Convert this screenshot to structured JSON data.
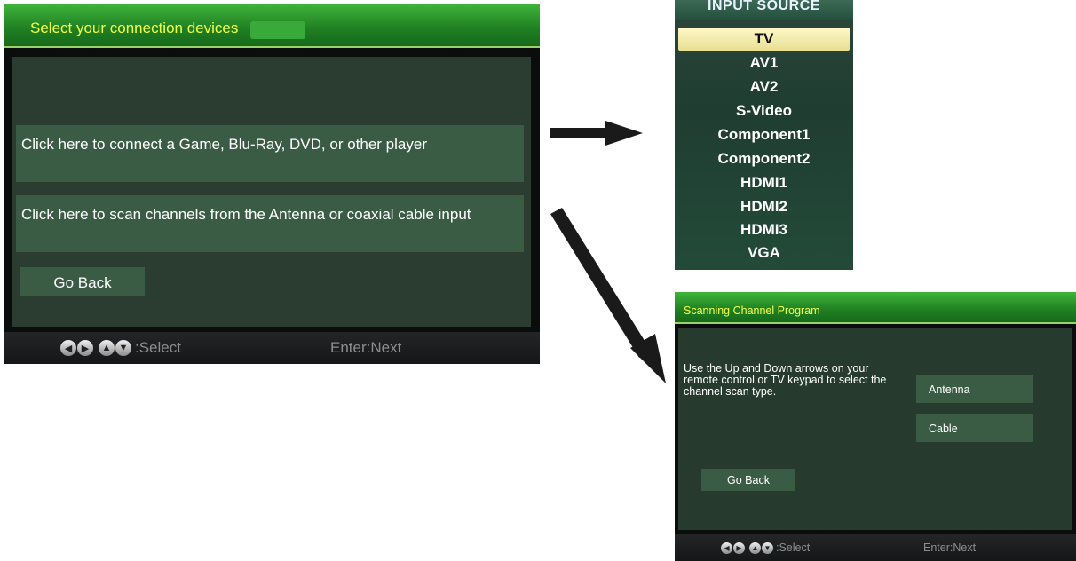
{
  "connection_screen": {
    "title": "Select your connection devices",
    "options": [
      {
        "label": "Click here to connect a Game, Blu-Ray, DVD, or other player"
      },
      {
        "label": "Click here to scan channels from the Antenna or coaxial cable input"
      }
    ],
    "go_back_label": "Go Back",
    "footer": {
      "select_label": ":Select",
      "next_label": "Enter:Next",
      "icons": [
        "left-arrow-icon",
        "right-arrow-icon",
        "up-arrow-icon",
        "down-arrow-icon"
      ]
    }
  },
  "input_source_menu": {
    "header": "INPUT SOURCE",
    "selected": "TV",
    "items": [
      "TV",
      "AV1",
      "AV2",
      "S-Video",
      "Component1",
      "Component2",
      "HDMI1",
      "HDMI2",
      "HDMI3",
      "VGA"
    ]
  },
  "scan_screen": {
    "title": "Scanning Channel Program",
    "description": "Use the Up and Down arrows on your remote control or TV keypad to select the channel scan type.",
    "options": [
      {
        "label": "Antenna"
      },
      {
        "label": "Cable"
      }
    ],
    "go_back_label": "Go Back",
    "footer": {
      "select_label": ":Select",
      "next_label": "Enter:Next"
    }
  },
  "colors": {
    "title_green": "#2e9b31",
    "title_text": "#f2ff4a",
    "panel_bg": "#2b3c30",
    "option_bg": "#3a5c45",
    "selected_bg": "#f7f0b0"
  }
}
